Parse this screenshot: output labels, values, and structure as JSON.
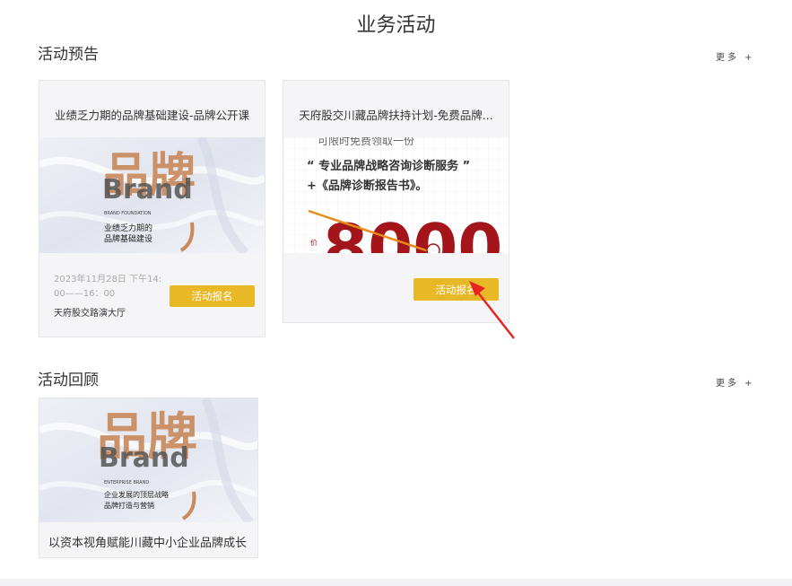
{
  "page": {
    "title": "业务活动"
  },
  "upcoming": {
    "title": "活动预告",
    "more": "更多 +",
    "cards": [
      {
        "title": "业绩乏力期的品牌基础建设-品牌公开课",
        "poster": {
          "calligraphy": "品牌",
          "brand_word": "Brand",
          "subtitle_small": "BRAND FOUNDATION",
          "line1": "业绩乏力期的",
          "line2": "品牌基础建设"
        },
        "datetime_line1": "2023年11月28日 下午14:",
        "datetime_line2": "00——16：00",
        "venue": "天府股交路演大厅",
        "button": "活动报名"
      },
      {
        "title": "天府股交川藏品牌扶持计划-免费品牌...",
        "poster": {
          "top_cut": "可限时免费领取一份",
          "line1": "“ 专业品牌战略咨询诊断服务 ”",
          "line2": "+《品牌诊断报告书》。",
          "price_tag": "价",
          "number": "8000"
        },
        "button": "活动报名"
      }
    ]
  },
  "review": {
    "title": "活动回顾",
    "more": "更多 +",
    "cards": [
      {
        "caption": "以资本视角赋能川藏中小企业品牌成长",
        "poster": {
          "calligraphy": "品牌",
          "brand_word": "Brand",
          "subtitle_small": "ENTERPRISE BRAND",
          "line1": "企业发展的顶层战略",
          "line2": "品牌打造与营销"
        }
      }
    ]
  },
  "colors": {
    "accent": "#e8b827",
    "card_bg": "#f5f5f7",
    "poster_red": "#a3141b",
    "calligraphy": "#c98a5e"
  }
}
